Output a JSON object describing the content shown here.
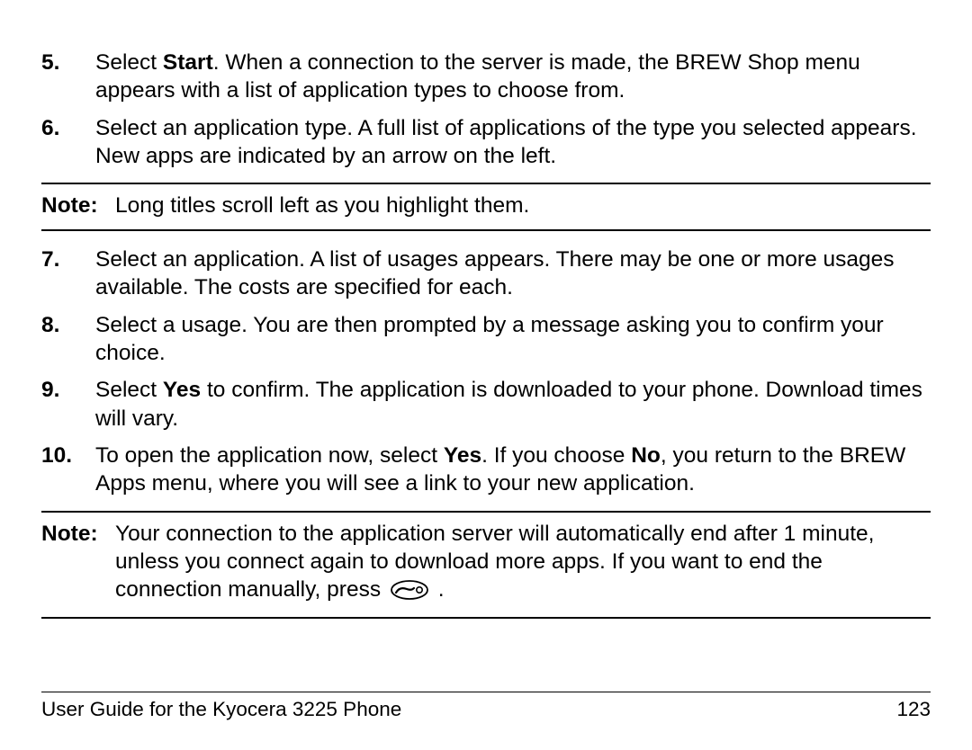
{
  "steps": [
    {
      "num": "5.",
      "prefix": "Select ",
      "bold1": "Start",
      "after1": ". When a connection to the server is made, the BREW Shop menu appears with a list of application types to choose from."
    },
    {
      "num": "6.",
      "text": "Select an application type. A full list of applications of the type you selected appears. New apps are indicated by an arrow on the left."
    }
  ],
  "note1": {
    "label": "Note:",
    "text": "Long titles scroll left as you highlight them."
  },
  "steps2": [
    {
      "num": "7.",
      "text": "Select an application. A list of usages appears. There may be one or more usages available. The costs are specified for each."
    },
    {
      "num": "8.",
      "text": "Select a usage. You are then prompted by a message asking you to confirm your choice."
    },
    {
      "num": "9.",
      "prefix": "Select ",
      "bold1": "Yes",
      "after1": " to confirm. The application is downloaded to your phone. Download times will vary."
    },
    {
      "num": "10.",
      "prefix": "To open the application now, select ",
      "bold1": "Yes",
      "mid": ". If you choose ",
      "bold2": "No",
      "after2": ", you return to the BREW Apps menu, where you will see a link to your new application."
    }
  ],
  "note2": {
    "label": "Note:",
    "text_before_icon": "Your connection to the application server will automatically end after 1 minute, unless you connect again to download more apps. If you want to end the connection manually, press ",
    "text_after_icon": " ."
  },
  "footer": {
    "left": "User Guide for the Kyocera 3225 Phone",
    "right": "123"
  }
}
